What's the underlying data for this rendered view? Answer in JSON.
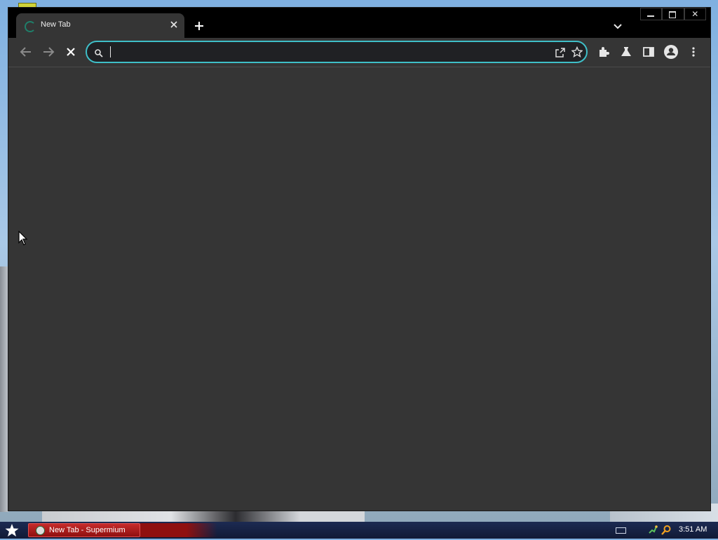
{
  "window": {
    "tab_title": "New Tab",
    "tab_close_icon": "close-icon",
    "new_tab_icon": "plus-icon",
    "tab_search_icon": "chevron-down-icon",
    "controls": {
      "minimize_icon": "minimize-icon",
      "maximize_icon": "maximize-icon",
      "close_glyph": "✕"
    }
  },
  "toolbar": {
    "back_icon": "arrow-left-icon",
    "forward_icon": "arrow-right-icon",
    "stop_icon": "close-icon",
    "omnibox": {
      "value": "",
      "search_icon": "search-icon",
      "share_icon": "share-icon",
      "bookmark_icon": "star-icon"
    },
    "extensions_icon": "puzzle-icon",
    "labs_icon": "flask-icon",
    "side_panel_icon": "side-panel-icon",
    "profile_icon": "avatar-icon",
    "menu_icon": "kebab-menu-icon"
  },
  "colors": {
    "accent": "#3fbfc8",
    "chrome_bg": "#353535",
    "titlebar_bg": "#000000",
    "taskbar_item": "#c62b2b"
  },
  "taskbar": {
    "start_icon": "star-icon",
    "items": [
      {
        "label": "New Tab - Supermium"
      }
    ],
    "tray": {
      "keyboard_icon": "keyboard-icon",
      "network_icon": "network-icon",
      "search_icon": "search-icon",
      "clock": "3:51 AM"
    }
  }
}
